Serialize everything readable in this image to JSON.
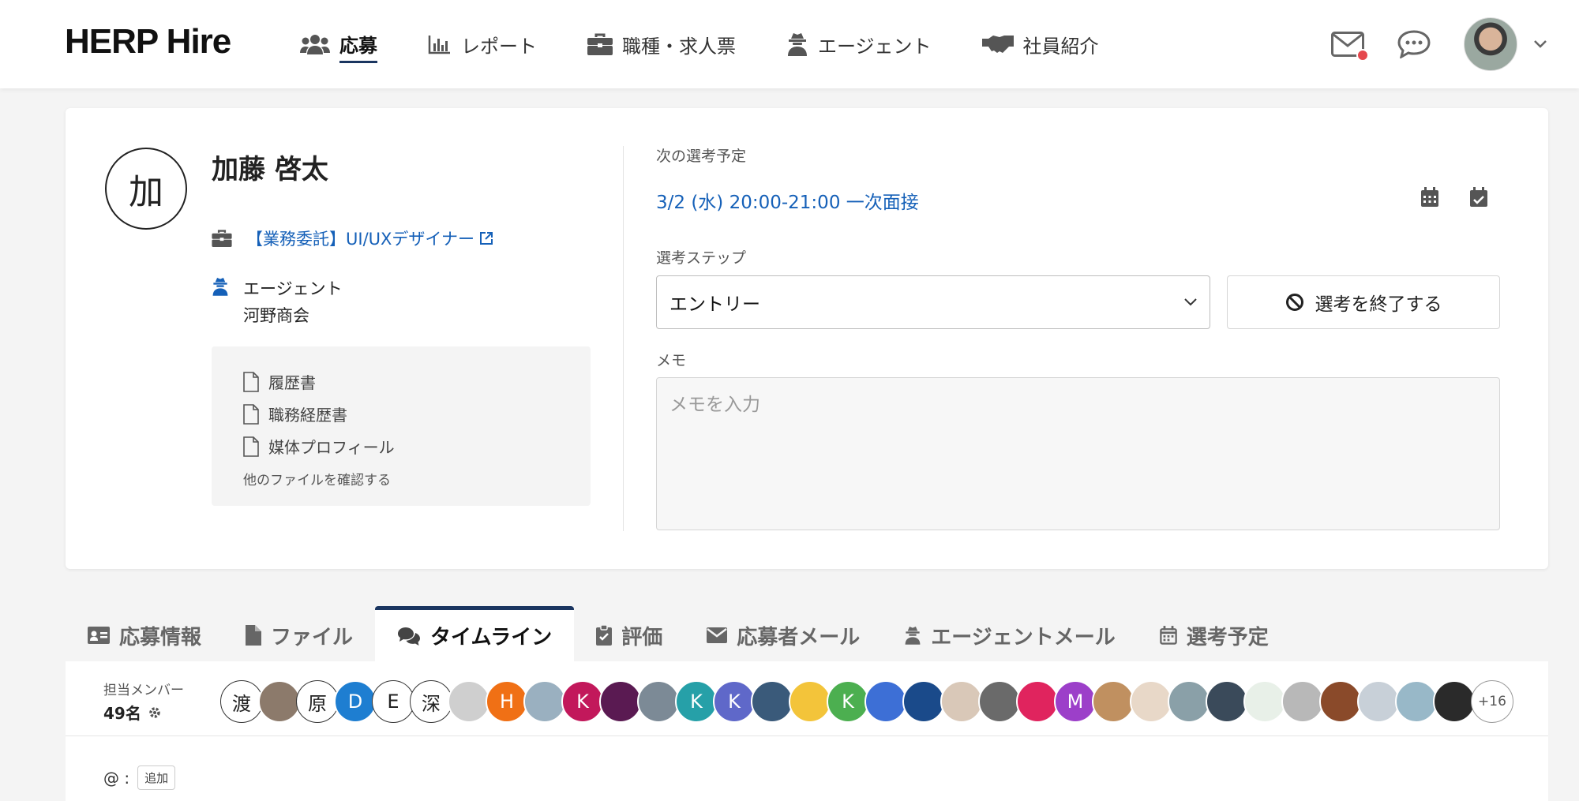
{
  "app": {
    "logo": "HERP Hire"
  },
  "nav": {
    "items": [
      {
        "label": "応募",
        "icon": "users-icon",
        "active": true
      },
      {
        "label": "レポート",
        "icon": "chart-icon",
        "active": false
      },
      {
        "label": "職種・求人票",
        "icon": "briefcase-icon",
        "active": false
      },
      {
        "label": "エージェント",
        "icon": "agent-icon",
        "active": false
      },
      {
        "label": "社員紹介",
        "icon": "handshake-icon",
        "active": false
      }
    ]
  },
  "candidate": {
    "initial": "加",
    "name": "加藤 啓太",
    "job": "【業務委託】UI/UXデザイナー",
    "agent_label": "エージェント",
    "agent_name": "河野商会",
    "files": [
      "履歴書",
      "職務経歴書",
      "媒体プロフィール"
    ],
    "more_files": "他のファイルを確認する"
  },
  "schedule": {
    "label": "次の選考予定",
    "next": "3/2 (水) 20:00-21:00 一次面接"
  },
  "step": {
    "label": "選考ステップ",
    "selected": "エントリー",
    "end_button": "選考を終了する"
  },
  "memo": {
    "label": "メモ",
    "placeholder": "メモを入力"
  },
  "tabs": [
    {
      "label": "応募情報",
      "icon": "id-card-icon",
      "active": false
    },
    {
      "label": "ファイル",
      "icon": "file-icon",
      "active": false
    },
    {
      "label": "タイムライン",
      "icon": "comments-icon",
      "active": true
    },
    {
      "label": "評価",
      "icon": "clipboard-icon",
      "active": false
    },
    {
      "label": "応募者メール",
      "icon": "envelope-icon",
      "active": false
    },
    {
      "label": "エージェントメール",
      "icon": "agent-icon",
      "active": false
    },
    {
      "label": "選考予定",
      "icon": "calendar-icon",
      "active": false
    }
  ],
  "members": {
    "label": "担当メンバー",
    "count": "49名",
    "avatars": [
      {
        "text": "渡",
        "style": "outline"
      },
      {
        "text": "",
        "color": "#8c7a6b"
      },
      {
        "text": "原",
        "style": "outline"
      },
      {
        "text": "D",
        "color": "#1e7ed1"
      },
      {
        "text": "E",
        "style": "outline"
      },
      {
        "text": "深",
        "style": "outline"
      },
      {
        "text": "",
        "color": "#cfcfcf"
      },
      {
        "text": "H",
        "color": "#f07015"
      },
      {
        "text": "",
        "color": "#9ab0c0"
      },
      {
        "text": "K",
        "color": "#c2185b"
      },
      {
        "text": "",
        "color": "#5a1a52"
      },
      {
        "text": "",
        "color": "#7c8a96"
      },
      {
        "text": "K",
        "color": "#26a0a8"
      },
      {
        "text": "K",
        "color": "#5f68c9"
      },
      {
        "text": "",
        "color": "#3a5a7a"
      },
      {
        "text": "",
        "color": "#f3c43a"
      },
      {
        "text": "K",
        "color": "#4caf50"
      },
      {
        "text": "",
        "color": "#3d6fd6"
      },
      {
        "text": "",
        "color": "#1a4a8a"
      },
      {
        "text": "",
        "color": "#d9c8b8"
      },
      {
        "text": "",
        "color": "#6a6a6a"
      },
      {
        "text": "",
        "color": "#e0245e"
      },
      {
        "text": "M",
        "color": "#9c3fc9"
      },
      {
        "text": "",
        "color": "#c09060"
      },
      {
        "text": "",
        "color": "#e8d8c8"
      },
      {
        "text": "",
        "color": "#8aa0a8"
      },
      {
        "text": "",
        "color": "#3a4a5a"
      },
      {
        "text": "",
        "color": "#e8f0e8"
      },
      {
        "text": "",
        "color": "#b8b8b8"
      },
      {
        "text": "",
        "color": "#8a4a2a"
      },
      {
        "text": "",
        "color": "#c8d0d8"
      },
      {
        "text": "",
        "color": "#98b8c8"
      },
      {
        "text": "",
        "color": "#2a2a2a"
      },
      {
        "text": "+16",
        "style": "more"
      }
    ]
  },
  "mention": {
    "prefix": "@ :",
    "add": "追加"
  },
  "colors": {
    "link": "#1560b8",
    "accent": "#1a3560",
    "notification": "#e5484d"
  }
}
